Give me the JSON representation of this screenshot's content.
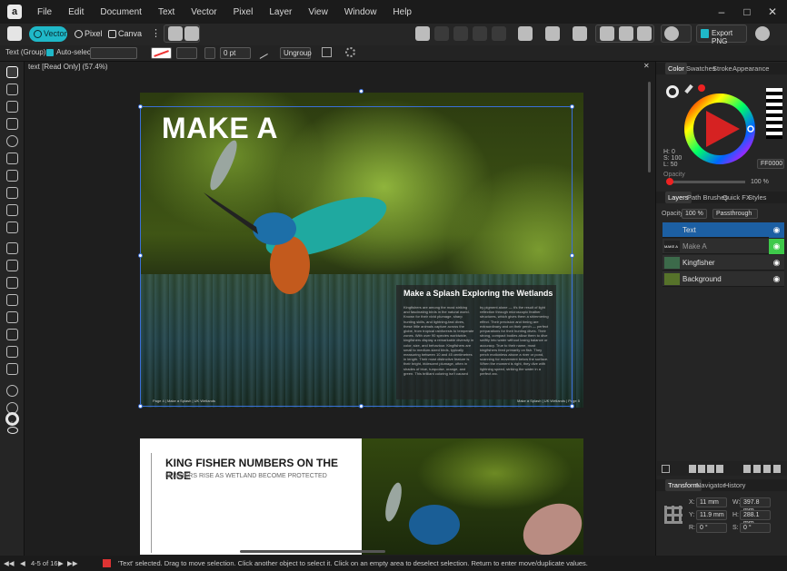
{
  "menu": {
    "items": [
      "File",
      "Edit",
      "Document",
      "Text",
      "Vector",
      "Pixel",
      "Layer",
      "View",
      "Window",
      "Help"
    ],
    "logo": "a"
  },
  "toolbar": {
    "vector_label": "Vector",
    "pixel_label": "Pixel",
    "canva_label": "Canva AI",
    "export_label": "Export PNG",
    "accent_color": "#1fb8c8"
  },
  "context": {
    "selection_type": "Text (Group)",
    "auto_select_label": "Auto-select:",
    "stroke_width": "0 pt",
    "ungroup_label": "Ungroup"
  },
  "document": {
    "tab_title": "text [Read Only] (57.4%)"
  },
  "page1": {
    "title": "MAKE A",
    "panel_heading": "Make a Splash Exploring the Wetlands",
    "col1": "Kingfishers are among the most striking and fascinating birds in the natural world. Known for their vivid plumage, sharp hunting skills, and lightning-fast dives, these little animals capture across the globe, from tropical rainforests to temperate zones. With over 90 species worldwide, kingfishers display a remarkable diversity in color, size, and behaviour. Kingfishers are small to medium-sized birds, typically measuring between 10 and 45 centimetres in length. Their most distinctive feature is their bright, iridescent plumage, often in shades of blue, turquoise, orange, and green. This brilliant coloring isn't caused",
    "col2": "by pigment alone — it's the result of light reflection through microscopic feather structures, which gives them a shimmering effect. Their precision and timing are extraordinary and on their perch — perfect preparations for their hunting dives. Their strong, compact bodies allow them to dive swiftly into water without losing balance or accuracy. True to their name, most kingfishers feed primarily on fish. They perch motionless above a river or pond, scanning for movement below the surface. When the moment is right, they dive with lightning speed, striking the water in a perfect arc.",
    "footer_left": "Page 4  |  Make a Splash  |  UK Wetlands",
    "footer_right": "Make a Splash  |  UK Wetlands  |  Page 5"
  },
  "page2": {
    "title": "KING FISHER NUMBERS ON THE RISE",
    "subtitle": "NUMBERS RISE AS WETLAND BECOME PROTECTED"
  },
  "color_panel": {
    "tabs": [
      "Color",
      "Swatches",
      "Stroke",
      "Appearance"
    ],
    "h": "H: 0",
    "s": "S: 100",
    "l": "L: 50",
    "hex": "FF0000",
    "opacity_label": "Opacity",
    "opacity_value": "100 %",
    "selected_color": "#ff0000"
  },
  "layers_panel": {
    "tabs": [
      "Layers",
      "Path Brushes",
      "Quick FX",
      "Styles"
    ],
    "opacity_label": "Opacity:",
    "opacity_value": "100 %",
    "blend_mode": "Passthrough",
    "layers": [
      {
        "name": "Text",
        "thumb": ""
      },
      {
        "name": "Make A",
        "thumb": "MAKE A"
      },
      {
        "name": "Kingfisher",
        "thumb": ""
      },
      {
        "name": "Background",
        "thumb": ""
      }
    ]
  },
  "transform_panel": {
    "tabs": [
      "Transform",
      "Navigator",
      "History"
    ],
    "x_label": "X:",
    "x_value": "11 mm",
    "y_label": "Y:",
    "y_value": "11.9 mm",
    "w_label": "W:",
    "w_value": "397.8 mm",
    "h_label": "H:",
    "h_value": "288.1 mm",
    "r_label": "R:",
    "r_value": "0 °",
    "s_label": "S:",
    "s_value": "0 °"
  },
  "status": {
    "page": "4-5 of 16",
    "message": "'Text' selected. Drag to move selection. Click another object to select it. Click on an empty area to deselect selection. Return to enter move/duplicate values."
  }
}
